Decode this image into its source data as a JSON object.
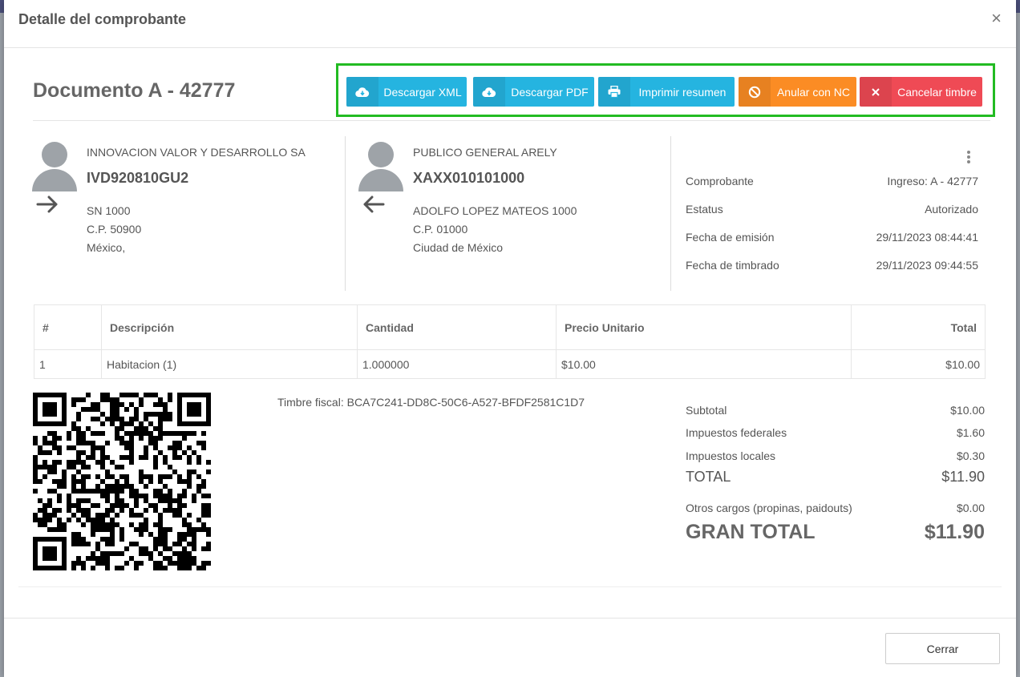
{
  "modal": {
    "title": "Detalle del comprobante",
    "close_symbol": "×"
  },
  "document": {
    "title": "Documento A - 42777"
  },
  "actions": {
    "download_xml": "Descargar XML",
    "download_pdf": "Descargar PDF",
    "print_summary": "Imprimir resumen",
    "cancel_nc": "Anular con NC",
    "cancel_stamp": "Cancelar timbre"
  },
  "issuer": {
    "name": "INNOVACION VALOR Y DESARROLLO SA",
    "rfc": "IVD920810GU2",
    "address1": "SN 1000",
    "address2": "C.P. 50900",
    "address3": "México,"
  },
  "receiver": {
    "name": "PUBLICO GENERAL ARELY",
    "rfc": "XAXX010101000",
    "address1": "ADOLFO LOPEZ MATEOS 1000",
    "address2": "C.P. 01000",
    "address3": "Ciudad de México"
  },
  "info": {
    "comprobante_label": "Comprobante",
    "comprobante_value": "Ingreso: A - 42777",
    "estatus_label": "Estatus",
    "estatus_value": "Autorizado",
    "emision_label": "Fecha de emisión",
    "emision_value": "29/11/2023 08:44:41",
    "timbrado_label": "Fecha de timbrado",
    "timbrado_value": "29/11/2023 09:44:55"
  },
  "table": {
    "headers": [
      "#",
      "Descripción",
      "Cantidad",
      "Precio Unitario",
      "Total"
    ],
    "rows": [
      [
        "1",
        "Habitacion (1)",
        "1.000000",
        "$10.00",
        "$10.00"
      ]
    ]
  },
  "timbre_fiscal": "Timbre fiscal: BCA7C241-DD8C-50C6-A527-BFDF2581C1D7",
  "totals": {
    "subtotal_label": "Subtotal",
    "subtotal_value": "$10.00",
    "federal_label": "Impuestos federales",
    "federal_value": "$1.60",
    "local_label": "Impuestos locales",
    "local_value": "$0.30",
    "total_label": "TOTAL",
    "total_value": "$11.90",
    "otros_label": "Otros cargos (propinas, paidouts)",
    "otros_value": "$0.00",
    "gran_total_label": "GRAN TOTAL",
    "gran_total_value": "$11.90"
  },
  "footer": {
    "close_label": "Cerrar"
  },
  "colors": {
    "cyan": "#25b4e0",
    "orange": "#fb8c24",
    "red": "#ef4a55",
    "highlight": "#22bb22"
  },
  "icons": [
    "cloud-download-icon",
    "printer-icon",
    "ban-icon",
    "x-icon",
    "user-icon",
    "arrow-right-icon",
    "arrow-left-icon",
    "kebab-menu-icon",
    "qr-code"
  ]
}
